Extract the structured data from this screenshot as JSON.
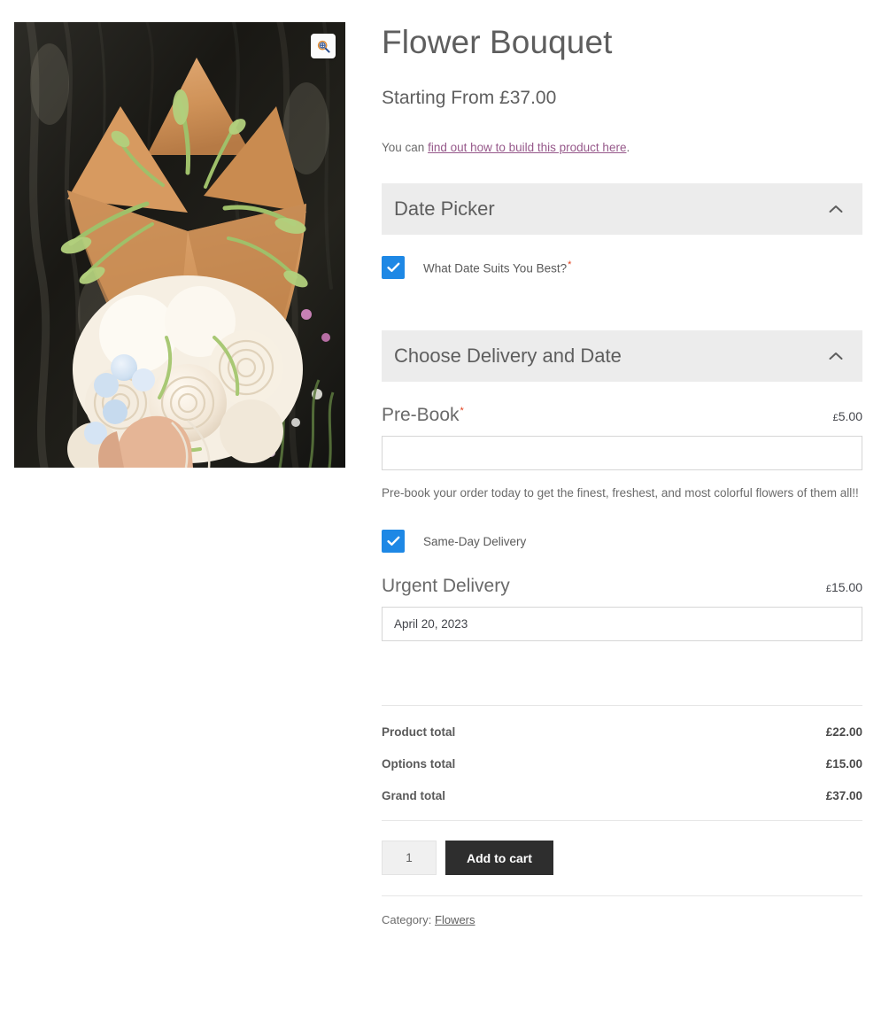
{
  "product": {
    "title": "Flower Bouquet",
    "price_label": "Starting From £37.00",
    "note_prefix": "You can ",
    "note_link": "find out how to build this product here",
    "note_suffix": ".",
    "image_alt": "flower-bouquet-photo",
    "zoom_icon": "magnifier-plus-icon"
  },
  "sections": [
    {
      "title": "Date Picker",
      "chevron": "chevron-up-icon",
      "checkbox": {
        "label": "What Date Suits You Best?",
        "required_mark": "*",
        "checked": true
      }
    },
    {
      "title": "Choose Delivery and Date",
      "chevron": "chevron-up-icon",
      "prebook": {
        "label": "Pre-Book",
        "required_mark": "*",
        "currency": "£",
        "price": "5.00",
        "input_value": "",
        "input_placeholder": "",
        "help": "Pre-book your order today to get the finest, freshest, and most colorful flowers of them all!!"
      },
      "same_day": {
        "label": "Same-Day Delivery",
        "checked": true
      },
      "urgent": {
        "label": "Urgent Delivery",
        "currency": "£",
        "price": "15.00",
        "date_value": "April 20, 2023"
      }
    }
  ],
  "totals": [
    {
      "label": "Product total",
      "amount": "£22.00"
    },
    {
      "label": "Options total",
      "amount": "£15.00"
    },
    {
      "label": "Grand total",
      "amount": "£37.00"
    }
  ],
  "cart": {
    "quantity": "1",
    "add_to_cart_label": "Add to cart"
  },
  "meta": {
    "category_label": "Category:",
    "category_value": "Flowers"
  },
  "colors": {
    "checkbox_blue": "#1e88e5",
    "link_purple": "#96588a",
    "section_bg": "#ececec",
    "button_dark": "#2e2e2e",
    "required_red": "#e2401c"
  }
}
